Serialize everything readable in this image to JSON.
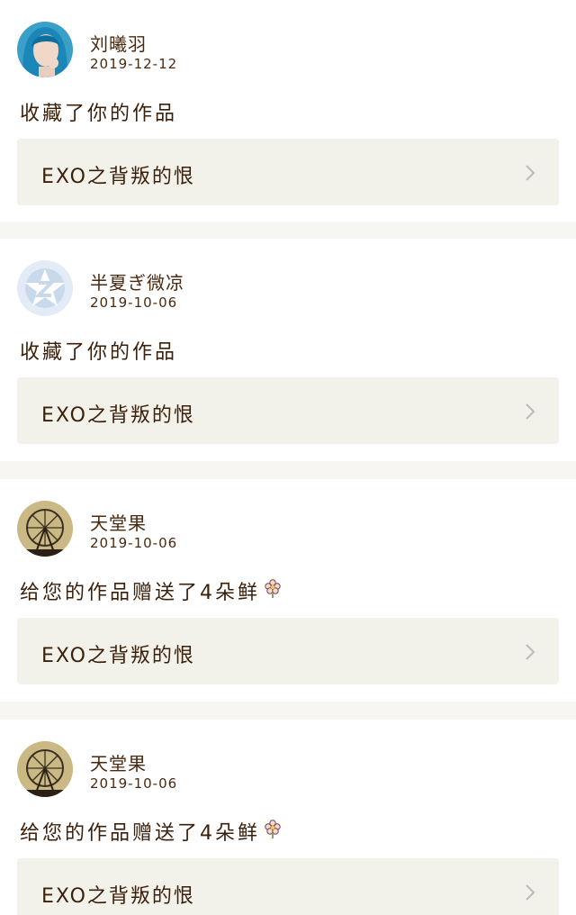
{
  "items": [
    {
      "username": "刘曦羽",
      "date": "2019-12-12",
      "action": "收藏了你的作品",
      "work_title": "EXO之背叛的恨",
      "avatar": "blue-hair-avatar"
    },
    {
      "username": "半夏ぎ微凉",
      "date": "2019-10-06",
      "action": "收藏了你的作品",
      "work_title": "EXO之背叛的恨",
      "avatar": "default-z-avatar"
    },
    {
      "username": "天堂果",
      "date": "2019-10-06",
      "action": "给您的作品赠送了4朵鲜",
      "work_title": "EXO之背叛的恨",
      "avatar": "ferris-wheel-avatar",
      "action_icon": "flower-icon"
    },
    {
      "username": "天堂果",
      "date": "2019-10-06",
      "action": "给您的作品赠送了4朵鲜",
      "work_title": "EXO之背叛的恨",
      "avatar": "ferris-wheel-avatar",
      "action_icon": "flower-icon"
    }
  ],
  "colors": {
    "background": "#f7f6f3",
    "card": "#ffffff",
    "work_box": "#f2f2ea",
    "text": "#3a1f0a",
    "chevron": "#bbbbbb"
  }
}
